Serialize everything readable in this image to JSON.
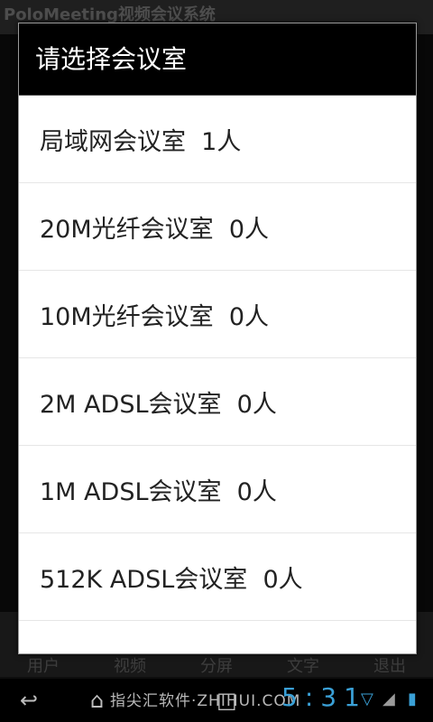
{
  "app": {
    "title": "PoloMeeting视频会议系统",
    "tabs": [
      "用户",
      "视频",
      "分屏",
      "文字",
      "退出"
    ]
  },
  "dialog": {
    "title": "请选择会议室",
    "rooms": [
      {
        "name": "局域网会议室",
        "count": "1人"
      },
      {
        "name": "20M光纤会议室",
        "count": "0人"
      },
      {
        "name": "10M光纤会议室",
        "count": "0人"
      },
      {
        "name": "2M ADSL会议室",
        "count": "0人"
      },
      {
        "name": "1M ADSL会议室",
        "count": "0人"
      },
      {
        "name": "512K ADSL会议室",
        "count": "0人"
      }
    ]
  },
  "status_bar": {
    "watermark": "指尖汇软件·ZHIHUI.COM",
    "clock": "5:31"
  },
  "icons": [
    "back-icon",
    "home-icon",
    "recent-apps-icon",
    "wifi-icon",
    "signal-icon",
    "battery-icon"
  ],
  "colors": {
    "accent": "#3aa0d6",
    "dialog_title_bg": "#000000"
  }
}
